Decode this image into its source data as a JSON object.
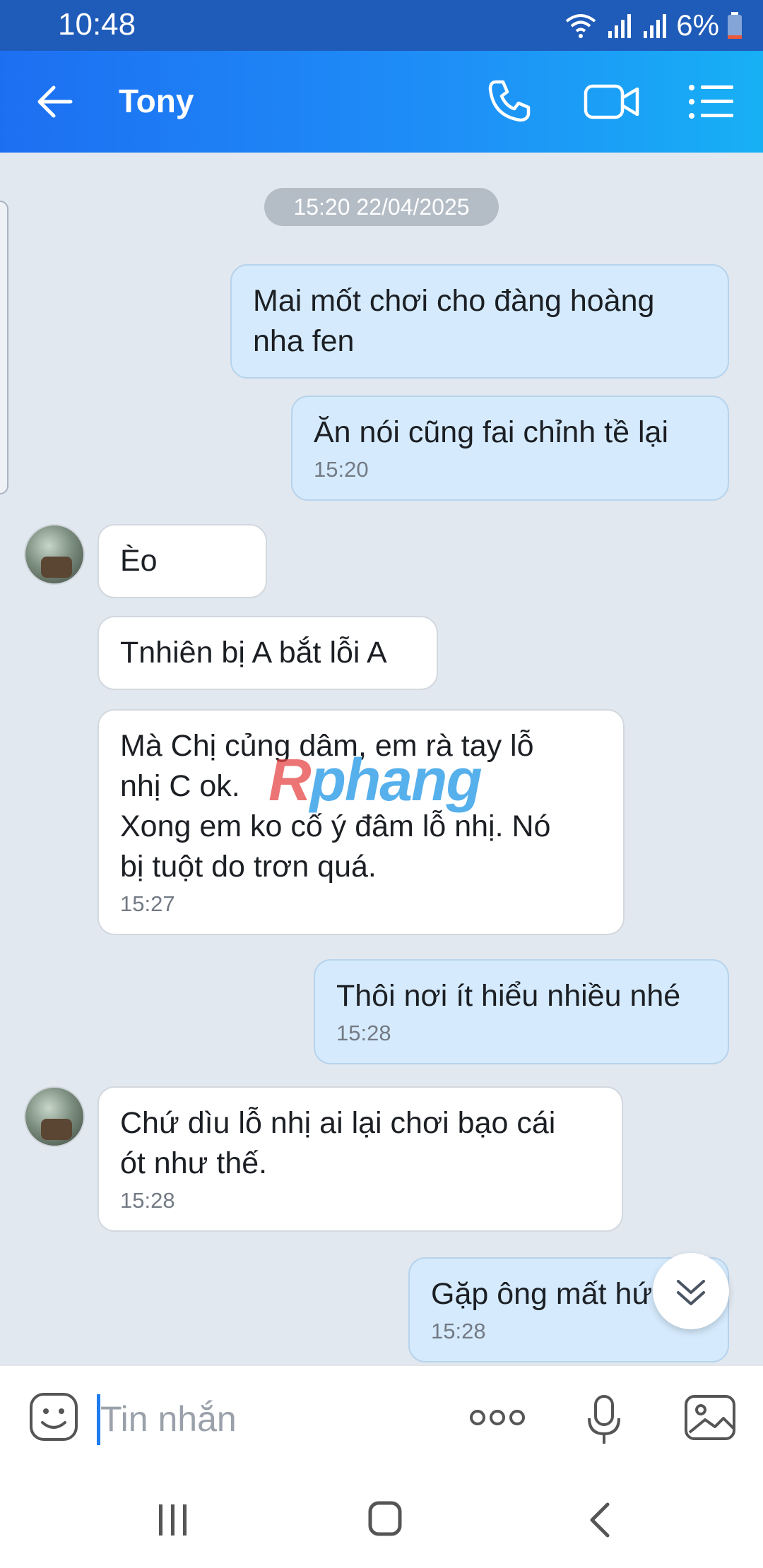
{
  "status_bar": {
    "time": "10:48",
    "battery": "6%"
  },
  "header": {
    "contact_name": "Tony"
  },
  "chat": {
    "date_divider": "15:20 22/04/2025",
    "watermark": {
      "prefix": "R",
      "rest": "phang"
    },
    "messages": [
      {
        "dir": "out",
        "text": "Mai mốt chơi cho đàng hoàng\nnha fen",
        "time": ""
      },
      {
        "dir": "out",
        "text": "Ăn nói cũng fai chỉnh tề lại",
        "time": "15:20"
      },
      {
        "dir": "in",
        "text": "Èo",
        "time": ""
      },
      {
        "dir": "in",
        "text": "Tnhiên bị A bắt lỗi A",
        "time": ""
      },
      {
        "dir": "in",
        "text": "Mà Chị củng dâm, em rà tay lỗ\nnhị C ok.\nXong em ko cố ý đâm lỗ nhị. Nó\nbị tuột do trơn quá.",
        "time": "15:27"
      },
      {
        "dir": "out",
        "text": "Thôi nơi ít hiểu nhiều nhé",
        "time": "15:28"
      },
      {
        "dir": "in",
        "text": "Chứ dìu lỗ nhị ai lại chơi bạo cái\nót như thế.",
        "time": "15:28"
      },
      {
        "dir": "out",
        "text": "Gặp ông mất hứ",
        "time": "15:28"
      }
    ]
  },
  "input": {
    "placeholder": "Tin nhắn"
  },
  "colors": {
    "header_start": "#1d6ff2",
    "header_end": "#17b0f5",
    "outgoing_bubble": "#d5ebfd",
    "incoming_bubble": "#ffffff",
    "chat_bg": "#e2e8f0"
  }
}
